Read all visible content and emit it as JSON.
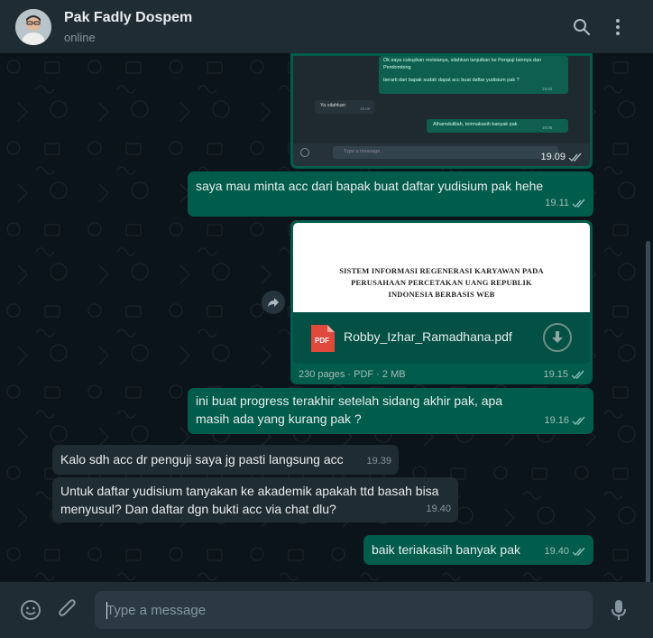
{
  "header": {
    "contact_name": "Pak Fadly Dospem",
    "status": "online"
  },
  "embedded_screenshot": {
    "lines": [
      "Ok saya cukupkan revisianya, silahkan lanjutkan ke Penguji lainnya dan",
      "Pembimbing",
      "berarti dari bapak sudah dapat acc buat daftar yudisium pak ?",
      "19.02",
      "Ya silahkan",
      "19.05",
      "Alhamdulillah, terimakasih banyak pak",
      "19.05",
      "Type a message"
    ],
    "time": "19.09"
  },
  "messages": [
    {
      "text": "saya mau minta acc dari bapak buat daftar yudisium pak hehe",
      "time": "19.11"
    },
    {
      "text": "ini buat progress terakhir setelah sidang akhir pak, apa masih ada yang kurang pak ?",
      "time": "19.16"
    },
    {
      "text": "Kalo sdh acc dr penguji saya jg pasti langsung acc",
      "time": "19.39"
    },
    {
      "text": "Untuk daftar yudisium tanyakan ke akademik apakah ttd basah bisa menyusul? Dan daftar dgn bukti acc via chat dlu?",
      "time": "19.40"
    },
    {
      "text": "baik teriakasih banyak pak",
      "time": "19.40"
    }
  ],
  "document": {
    "preview_lines": [
      "SISTEM INFORMASI REGENERASI KARYAWAN PADA",
      "PERUSAHAAN PERCETAKAN UANG REPUBLIK",
      "INDONESIA BERBASIS WEB"
    ],
    "icon_label": "PDF",
    "file_name": "Robby_Izhar_Ramadhana.pdf",
    "info": "230 pages · PDF · 2 MB",
    "time": "19.15"
  },
  "composer": {
    "placeholder": "Type a message"
  },
  "colors": {
    "outgoing_bubble": "#005c4b",
    "incoming_bubble": "#202c33",
    "header": "#202c33",
    "chat_bg": "#0b141a",
    "read_tick": "#53bdeb"
  },
  "icons": [
    "search-icon",
    "menu-icon",
    "emoji-icon",
    "attach-icon",
    "mic-icon",
    "forward-icon",
    "download-icon",
    "double-tick-icon",
    "pdf-icon"
  ]
}
